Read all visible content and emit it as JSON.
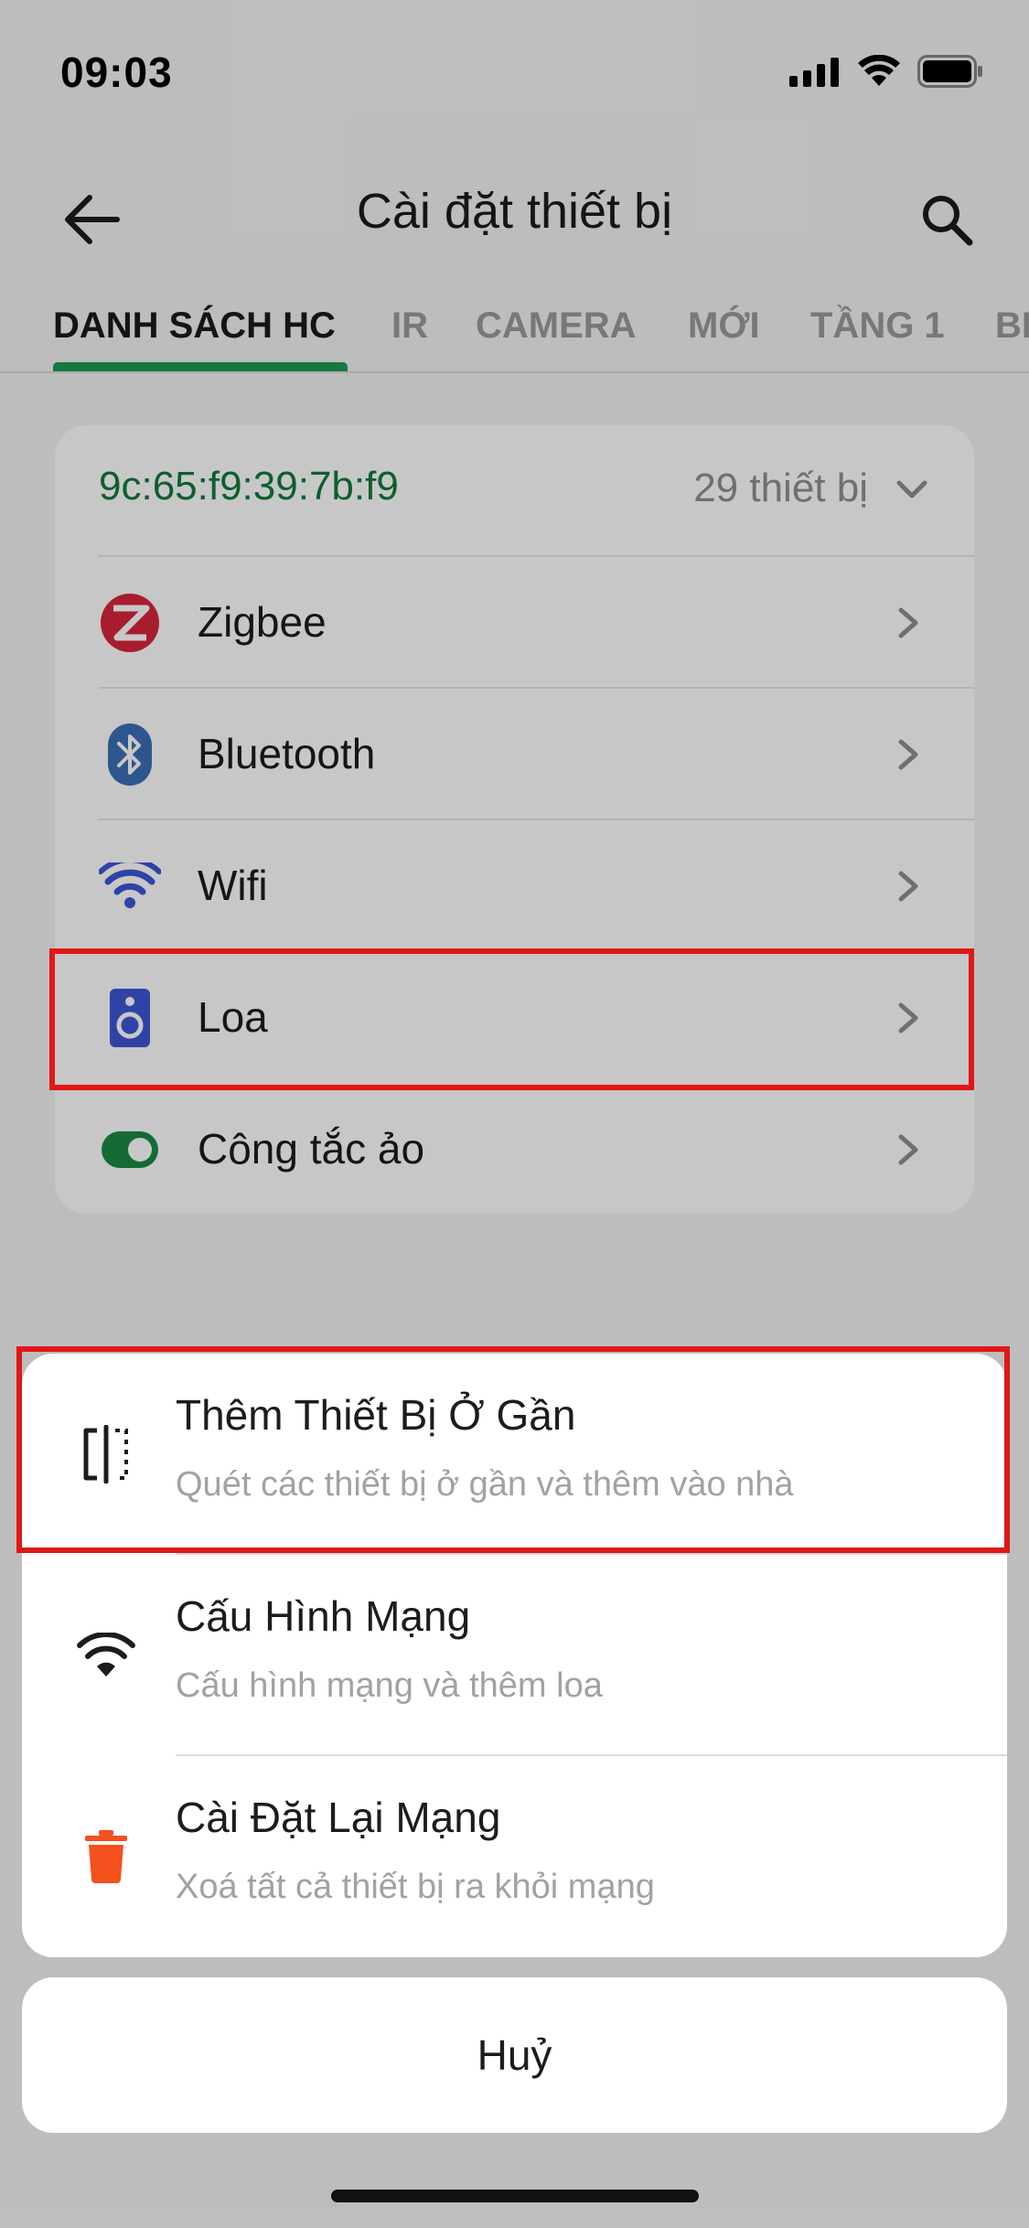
{
  "status_bar": {
    "time": "09:03"
  },
  "header": {
    "title": "Cài đặt thiết bị"
  },
  "tabs": [
    {
      "label": "DANH SÁCH HC",
      "active": true
    },
    {
      "label": "IR",
      "active": false
    },
    {
      "label": "CAMERA",
      "active": false
    },
    {
      "label": "MỚI",
      "active": false
    },
    {
      "label": "TẦNG 1",
      "active": false
    },
    {
      "label": "BẾ",
      "active": false
    }
  ],
  "hub_card": {
    "mac": "9c:65:f9:39:7b:f9",
    "device_count": "29 thiết bị",
    "items": [
      {
        "label": "Zigbee",
        "icon": "zigbee-icon"
      },
      {
        "label": "Bluetooth",
        "icon": "bluetooth-icon"
      },
      {
        "label": "Wifi",
        "icon": "wifi-icon"
      },
      {
        "label": "Loa",
        "icon": "speaker-icon"
      },
      {
        "label": "Công tắc ảo",
        "icon": "toggle-switch-icon"
      }
    ]
  },
  "action_sheet": {
    "items": [
      {
        "title": "Thêm Thiết Bị Ở Gần",
        "subtitle": "Quét các thiết bị ở gần và thêm vào nhà",
        "icon": "nearby-scan-icon"
      },
      {
        "title": "Cấu Hình Mạng",
        "subtitle": "Cấu hình mạng và thêm loa",
        "icon": "wifi-icon"
      },
      {
        "title": "Cài Đặt Lại Mạng",
        "subtitle": "Xoá tất cả thiết bị ra khỏi mạng",
        "icon": "trash-icon"
      }
    ],
    "cancel_label": "Huỷ"
  },
  "colors": {
    "accent_green": "#1f9a55",
    "mac_green": "#117a3a",
    "highlight_red": "#e01717",
    "trash_orange": "#f4511e",
    "icon_blue": "#3d57d6"
  }
}
